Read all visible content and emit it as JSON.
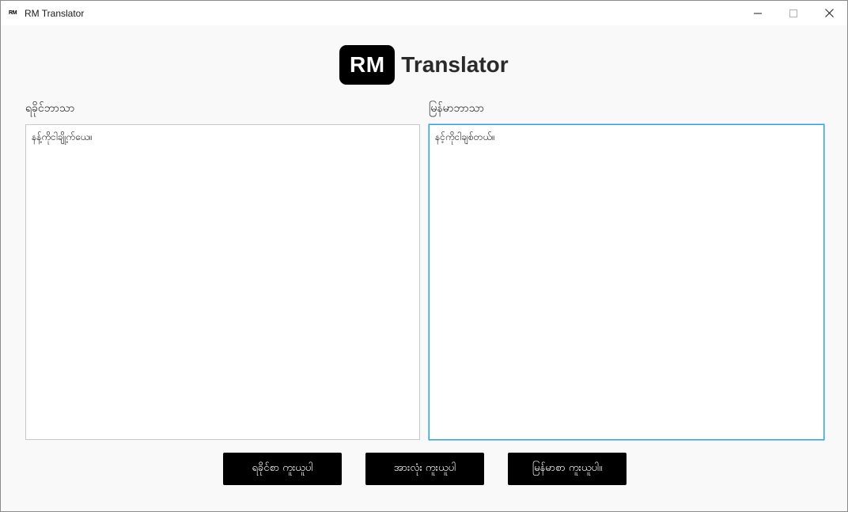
{
  "window": {
    "app_icon_text": "RM",
    "title": "RM Translator",
    "controls": {
      "minimize": "minimize-icon",
      "maximize": "maximize-icon",
      "close": "close-icon"
    }
  },
  "header": {
    "logo_badge": "RM",
    "logo_text": "Translator"
  },
  "panes": {
    "left": {
      "label": "ရခိုင်ဘာသာ",
      "value": "နန့်ကိုငါချို့က်ယေ။"
    },
    "right": {
      "label": "မြန်မာဘာသာ",
      "value": "နင့်ကိုငါချစ်တယ်။"
    }
  },
  "actions": {
    "copy_rakhine": "ရခိုင်စာ ကူးယူပါ",
    "copy_all": "အားလုံး ကူးယူပါ",
    "copy_myanmar": "မြန်မာစာ ကူးယူပါ။"
  },
  "colors": {
    "focus_border": "#2aa4dc",
    "button_bg": "#000000",
    "button_text": "#ffffff"
  }
}
